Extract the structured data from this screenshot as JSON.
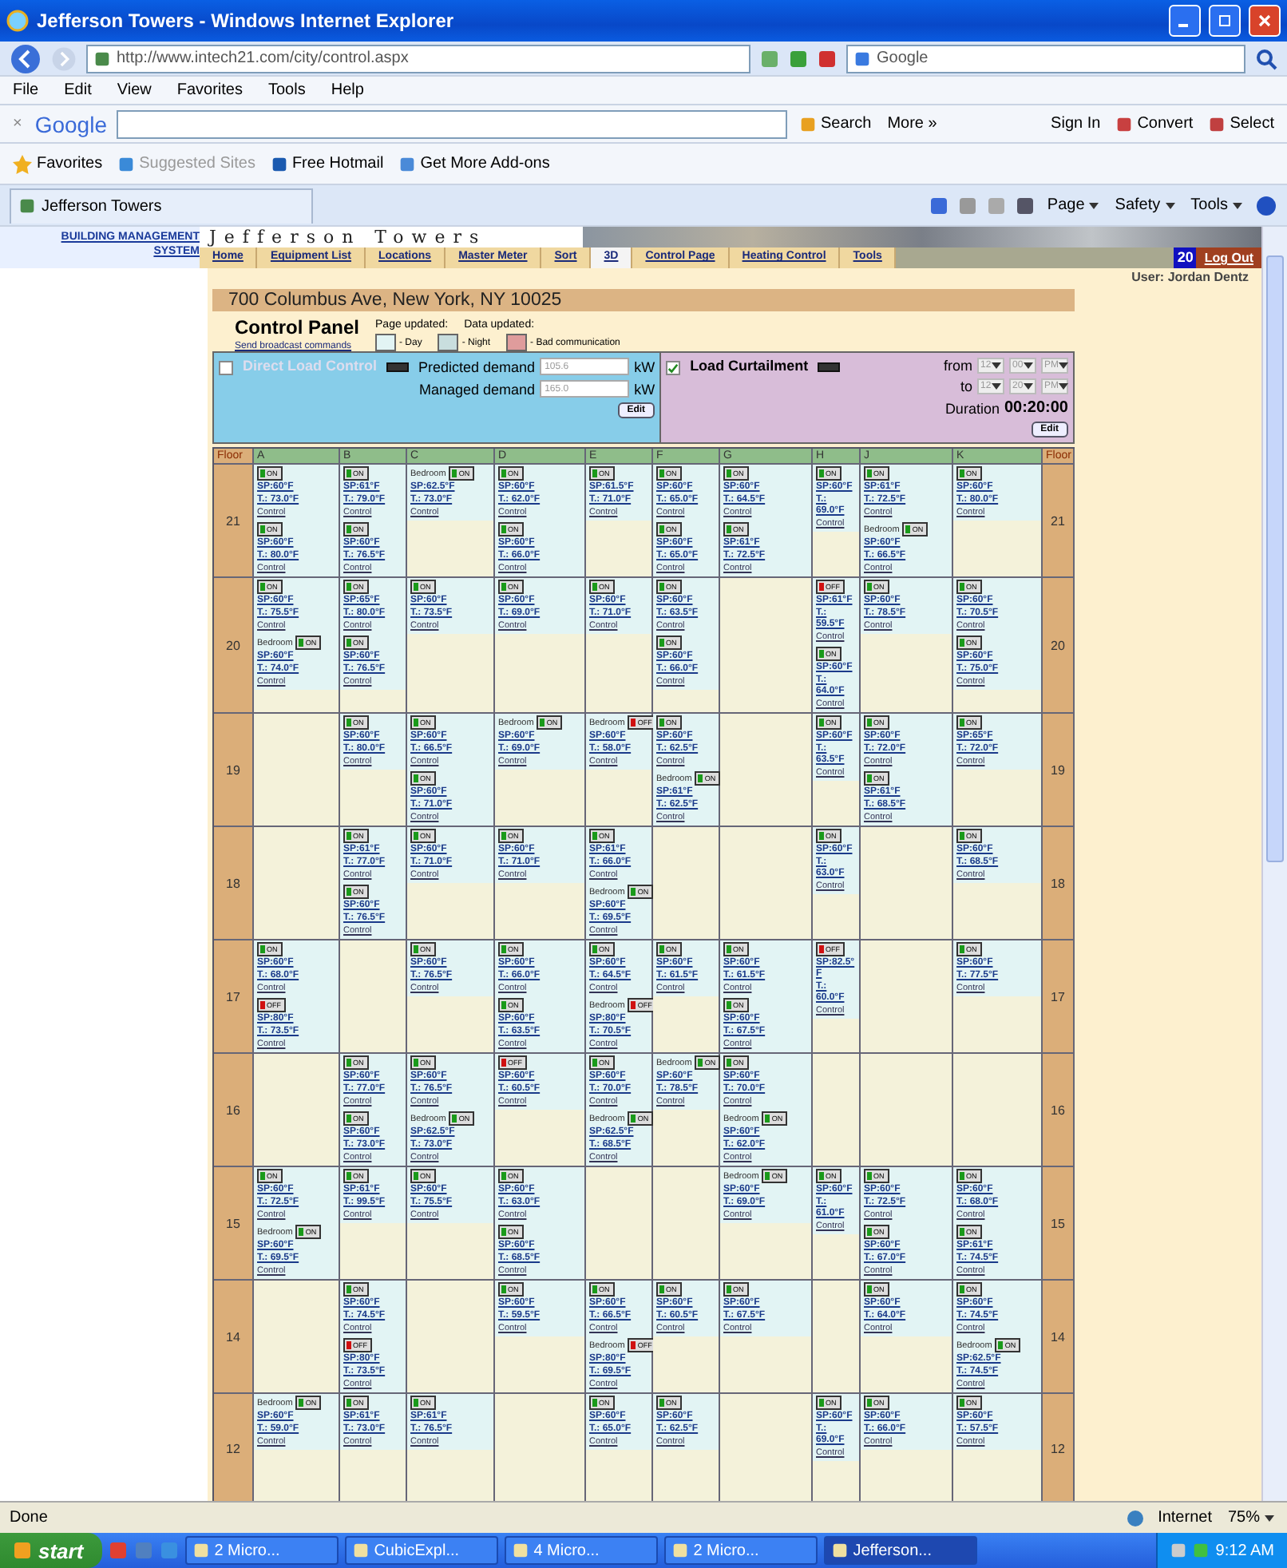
{
  "window": {
    "title": "Jefferson Towers - Windows Internet Explorer"
  },
  "address_bar": {
    "url": "http://www.intech21.com/city/control.aspx",
    "search_placeholder": "Google"
  },
  "menu": [
    "File",
    "Edit",
    "View",
    "Favorites",
    "Tools",
    "Help"
  ],
  "google_toolbar": {
    "close": "×",
    "logo": "Google",
    "search": "Search",
    "more": "More »",
    "sign_in": "Sign In",
    "convert": "Convert",
    "select": "Select"
  },
  "favorites_bar": {
    "favorites": "Favorites",
    "items": [
      "Suggested Sites",
      "Free Hotmail",
      "Get More Add-ons"
    ]
  },
  "tab": {
    "title": "Jefferson Towers"
  },
  "command_bar": [
    "Page",
    "Safety",
    "Tools"
  ],
  "site": {
    "brand": "BUILDING MANAGEMENT SYSTEM",
    "banner": "Jefferson Towers",
    "nav": [
      {
        "label": "Home",
        "selected": false
      },
      {
        "label": "Equipment List",
        "selected": false
      },
      {
        "label": "Locations",
        "selected": false
      },
      {
        "label": "Master Meter",
        "selected": false
      },
      {
        "label": "Sort",
        "selected": false
      },
      {
        "label": "3D",
        "selected": true
      },
      {
        "label": "Control Page",
        "selected": false
      },
      {
        "label": "Heating Control",
        "selected": false
      },
      {
        "label": "Tools",
        "selected": false
      }
    ],
    "badge": "20",
    "logout": "Log Out",
    "user": "User: Jordan Dentz"
  },
  "panel": {
    "address": "700 Columbus Ave, New York, NY 10025",
    "title": "Control Panel",
    "page_updated": "Page updated:",
    "data_updated": "Data updated:",
    "broadcast": "Send broadcast commands",
    "legend": [
      {
        "label": "- Day",
        "color": "#e2f4f4"
      },
      {
        "label": "- Night",
        "color": "#c9dede"
      },
      {
        "label": "- Bad communication",
        "color": "#df9c9c"
      }
    ]
  },
  "direct_load": {
    "checked": false,
    "label": "Direct Load Control",
    "predicted_label": "Predicted demand",
    "predicted": "105.6",
    "predicted_unit": "kW",
    "managed_label": "Managed demand",
    "managed": "165.0",
    "managed_unit": "kW",
    "edit": "Edit"
  },
  "curtailment": {
    "checked": true,
    "label": "Load Curtailment",
    "from_label": "from",
    "from": [
      "12",
      "00",
      "PM"
    ],
    "to_label": "to",
    "to": [
      "12",
      "20",
      "PM"
    ],
    "duration_label": "Duration",
    "duration": "00:20:00",
    "edit": "Edit"
  },
  "grid": {
    "columns": [
      "Floor",
      "A",
      "B",
      "C",
      "D",
      "E",
      "F",
      "G",
      "H",
      "J",
      "K",
      "Floor"
    ],
    "floors": [
      {
        "floor": "21",
        "floor_end": "21",
        "cells": [
          [
            {
              "switch": "ON",
              "on": true,
              "sp": "SP:60°F",
              "t": "T.: 73.0°F",
              "link": "Control"
            },
            {
              "switch": "ON",
              "on": true,
              "sp": "SP:60°F",
              "t": "T.: 80.0°F",
              "link": "Control"
            }
          ],
          [
            {
              "switch": "ON",
              "on": true,
              "sp": "SP:61°F",
              "t": "T.: 79.0°F",
              "link": "Control"
            },
            {
              "switch": "ON",
              "on": true,
              "sp": "SP:60°F",
              "t": "T.: 76.5°F",
              "link": "Control"
            }
          ],
          [
            {
              "room": "Bedroom",
              "switch": "ON",
              "on": true,
              "sp": "SP:62.5°F",
              "t": "T.: 73.0°F",
              "link": "Control"
            }
          ],
          [
            {
              "switch": "ON",
              "on": true,
              "sp": "SP:60°F",
              "t": "T.: 62.0°F",
              "link": "Control"
            },
            {
              "switch": "ON",
              "on": true,
              "sp": "SP:60°F",
              "t": "T.: 66.0°F",
              "link": "Control"
            }
          ],
          [
            {
              "switch": "ON",
              "on": true,
              "sp": "SP:61.5°F",
              "t": "T.: 71.0°F",
              "link": "Control"
            }
          ],
          [
            {
              "switch": "ON",
              "on": true,
              "sp": "SP:60°F",
              "t": "T.: 65.0°F",
              "link": "Control"
            },
            {
              "switch": "ON",
              "on": true,
              "sp": "SP:60°F",
              "t": "T.: 65.0°F",
              "link": "Control"
            }
          ],
          [
            {
              "switch": "ON",
              "on": true,
              "sp": "SP:60°F",
              "t": "T.: 64.5°F",
              "link": "Control"
            },
            {
              "switch": "ON",
              "on": true,
              "sp": "SP:61°F",
              "t": "T.: 72.5°F",
              "link": "Control"
            }
          ],
          [
            {
              "switch": "ON",
              "on": true,
              "sp": "SP:60°F",
              "t": "T.: 69.0°F",
              "link": "Control"
            }
          ],
          [
            {
              "switch": "ON",
              "on": true,
              "sp": "SP:61°F",
              "t": "T.: 72.5°F",
              "link": "Control"
            },
            {
              "room": "Bedroom",
              "switch": "ON",
              "on": true,
              "sp": "SP:60°F",
              "t": "T.: 66.5°F",
              "link": "Control"
            }
          ],
          [
            {
              "switch": "ON",
              "on": true,
              "sp": "SP:60°F",
              "t": "T.: 80.0°F",
              "link": "Control"
            }
          ]
        ]
      },
      {
        "floor": "20",
        "floor_end": "20",
        "cells": [
          [
            {
              "switch": "ON",
              "on": true,
              "sp": "SP:60°F",
              "t": "T.: 75.5°F",
              "link": "Control"
            },
            {
              "room": "Bedroom",
              "switch": "ON",
              "on": true,
              "sp": "SP:60°F",
              "t": "T.: 74.0°F",
              "link": "Control"
            }
          ],
          [
            {
              "switch": "ON",
              "on": true,
              "sp": "SP:65°F",
              "t": "T.: 80.0°F",
              "link": "Control"
            },
            {
              "switch": "ON",
              "on": true,
              "sp": "SP:60°F",
              "t": "T.: 76.5°F",
              "link": "Control"
            }
          ],
          [
            {
              "switch": "ON",
              "on": true,
              "sp": "SP:60°F",
              "t": "T.: 73.5°F",
              "link": "Control"
            }
          ],
          [
            {
              "switch": "ON",
              "on": true,
              "sp": "SP:60°F",
              "t": "T.: 69.0°F",
              "link": "Control"
            }
          ],
          [
            {
              "switch": "ON",
              "on": true,
              "sp": "SP:60°F",
              "t": "T.: 71.0°F",
              "link": "Control"
            }
          ],
          [
            {
              "switch": "ON",
              "on": true,
              "sp": "SP:60°F",
              "t": "T.: 63.5°F",
              "link": "Control"
            },
            {
              "switch": "ON",
              "on": true,
              "sp": "SP:60°F",
              "t": "T.: 66.0°F",
              "link": "Control"
            }
          ],
          [],
          [
            {
              "switch": "OFF",
              "on": false,
              "sp": "SP:61°F",
              "t": "T.: 59.5°F",
              "link": "Control"
            },
            {
              "switch": "ON",
              "on": true,
              "sp": "SP:60°F",
              "t": "T.: 64.0°F",
              "link": "Control"
            }
          ],
          [
            {
              "switch": "ON",
              "on": true,
              "sp": "SP:60°F",
              "t": "T.: 78.5°F",
              "link": "Control"
            }
          ],
          [
            {
              "switch": "ON",
              "on": true,
              "sp": "SP:60°F",
              "t": "T.: 70.5°F",
              "link": "Control"
            },
            {
              "switch": "ON",
              "on": true,
              "sp": "SP:60°F",
              "t": "T.: 75.0°F",
              "link": "Control"
            }
          ]
        ]
      },
      {
        "floor": "19",
        "floor_end": "19",
        "cells": [
          [],
          [
            {
              "switch": "ON",
              "on": true,
              "sp": "SP:60°F",
              "t": "T.: 80.0°F",
              "link": "Control"
            }
          ],
          [
            {
              "switch": "ON",
              "on": true,
              "sp": "SP:60°F",
              "t": "T.: 66.5°F",
              "link": "Control"
            },
            {
              "switch": "ON",
              "on": true,
              "sp": "SP:60°F",
              "t": "T.: 71.0°F",
              "link": "Control"
            }
          ],
          [
            {
              "room": "Bedroom",
              "switch": "ON",
              "on": true,
              "sp": "SP:60°F",
              "t": "T.: 69.0°F",
              "link": "Control"
            }
          ],
          [
            {
              "room": "Bedroom",
              "switch": "OFF",
              "on": false,
              "sp": "SP:60°F",
              "t": "T.: 58.0°F",
              "link": "Control"
            }
          ],
          [
            {
              "switch": "ON",
              "on": true,
              "sp": "SP:60°F",
              "t": "T.: 62.5°F",
              "link": "Control"
            },
            {
              "room": "Bedroom",
              "switch": "ON",
              "on": true,
              "sp": "SP:61°F",
              "t": "T.: 62.5°F",
              "link": "Control"
            }
          ],
          [],
          [
            {
              "switch": "ON",
              "on": true,
              "sp": "SP:60°F",
              "t": "T.: 63.5°F",
              "link": "Control"
            }
          ],
          [
            {
              "switch": "ON",
              "on": true,
              "sp": "SP:60°F",
              "t": "T.: 72.0°F",
              "link": "Control"
            },
            {
              "switch": "ON",
              "on": true,
              "sp": "SP:61°F",
              "t": "T.: 68.5°F",
              "link": "Control"
            }
          ],
          [
            {
              "switch": "ON",
              "on": true,
              "sp": "SP:65°F",
              "t": "T.: 72.0°F",
              "link": "Control"
            }
          ]
        ]
      },
      {
        "floor": "18",
        "floor_end": "18",
        "cells": [
          [],
          [
            {
              "switch": "ON",
              "on": true,
              "sp": "SP:61°F",
              "t": "T.: 77.0°F",
              "link": "Control"
            },
            {
              "switch": "ON",
              "on": true,
              "sp": "SP:60°F",
              "t": "T.: 76.5°F",
              "link": "Control"
            }
          ],
          [
            {
              "switch": "ON",
              "on": true,
              "sp": "SP:60°F",
              "t": "T.: 71.0°F",
              "link": "Control"
            }
          ],
          [
            {
              "switch": "ON",
              "on": true,
              "sp": "SP:60°F",
              "t": "T.: 71.0°F",
              "link": "Control"
            }
          ],
          [
            {
              "switch": "ON",
              "on": true,
              "sp": "SP:61°F",
              "t": "T.: 66.0°F",
              "link": "Control"
            },
            {
              "room": "Bedroom",
              "switch": "ON",
              "on": true,
              "sp": "SP:60°F",
              "t": "T.: 69.5°F",
              "link": "Control"
            }
          ],
          [],
          [],
          [
            {
              "switch": "ON",
              "on": true,
              "sp": "SP:60°F",
              "t": "T.: 63.0°F",
              "link": "Control"
            }
          ],
          [],
          [
            {
              "switch": "ON",
              "on": true,
              "sp": "SP:60°F",
              "t": "T.: 68.5°F",
              "link": "Control"
            }
          ]
        ]
      },
      {
        "floor": "17",
        "floor_end": "17",
        "cells": [
          [
            {
              "switch": "ON",
              "on": true,
              "sp": "SP:60°F",
              "t": "T.: 68.0°F",
              "link": "Control"
            },
            {
              "switch": "OFF",
              "on": false,
              "sp": "SP:80°F",
              "t": "T.: 73.5°F",
              "link": "Control"
            }
          ],
          [],
          [
            {
              "switch": "ON",
              "on": true,
              "sp": "SP:60°F",
              "t": "T.: 76.5°F",
              "link": "Control"
            }
          ],
          [
            {
              "switch": "ON",
              "on": true,
              "sp": "SP:60°F",
              "t": "T.: 66.0°F",
              "link": "Control"
            },
            {
              "switch": "ON",
              "on": true,
              "sp": "SP:60°F",
              "t": "T.: 63.5°F",
              "link": "Control"
            }
          ],
          [
            {
              "switch": "ON",
              "on": true,
              "sp": "SP:60°F",
              "t": "T.: 64.5°F",
              "link": "Control"
            },
            {
              "room": "Bedroom",
              "switch": "OFF",
              "on": false,
              "sp": "SP:80°F",
              "t": "T.: 70.5°F",
              "link": "Control"
            }
          ],
          [
            {
              "switch": "ON",
              "on": true,
              "sp": "SP:60°F",
              "t": "T.: 61.5°F",
              "link": "Control"
            }
          ],
          [
            {
              "switch": "ON",
              "on": true,
              "sp": "SP:60°F",
              "t": "T.: 61.5°F",
              "link": "Control"
            },
            {
              "switch": "ON",
              "on": true,
              "sp": "SP:60°F",
              "t": "T.: 67.5°F",
              "link": "Control"
            }
          ],
          [
            {
              "switch": "OFF",
              "on": false,
              "sp": "SP:82.5°F",
              "t": "T.: 60.0°F",
              "link": "Control"
            }
          ],
          [],
          [
            {
              "switch": "ON",
              "on": true,
              "sp": "SP:60°F",
              "t": "T.: 77.5°F",
              "link": "Control"
            }
          ]
        ]
      },
      {
        "floor": "16",
        "floor_end": "16",
        "cells": [
          [],
          [
            {
              "switch": "ON",
              "on": true,
              "sp": "SP:60°F",
              "t": "T.: 77.0°F",
              "link": "Control"
            },
            {
              "switch": "ON",
              "on": true,
              "sp": "SP:60°F",
              "t": "T.: 73.0°F",
              "link": "Control"
            }
          ],
          [
            {
              "switch": "ON",
              "on": true,
              "sp": "SP:60°F",
              "t": "T.: 76.5°F",
              "link": "Control"
            },
            {
              "room": "Bedroom",
              "switch": "ON",
              "on": true,
              "sp": "SP:62.5°F",
              "t": "T.: 73.0°F",
              "link": "Control"
            }
          ],
          [
            {
              "switch": "OFF",
              "on": false,
              "sp": "SP:60°F",
              "t": "T.: 60.5°F",
              "link": "Control"
            }
          ],
          [
            {
              "switch": "ON",
              "on": true,
              "sp": "SP:60°F",
              "t": "T.: 70.0°F",
              "link": "Control"
            },
            {
              "room": "Bedroom",
              "switch": "ON",
              "on": true,
              "sp": "SP:62.5°F",
              "t": "T.: 68.5°F",
              "link": "Control"
            }
          ],
          [
            {
              "room": "Bedroom",
              "switch": "ON",
              "on": true,
              "sp": "SP:60°F",
              "t": "T.: 78.5°F",
              "link": "Control"
            }
          ],
          [
            {
              "switch": "ON",
              "on": true,
              "sp": "SP:60°F",
              "t": "T.: 70.0°F",
              "link": "Control"
            },
            {
              "room": "Bedroom",
              "switch": "ON",
              "on": true,
              "sp": "SP:60°F",
              "t": "T.: 62.0°F",
              "link": "Control"
            }
          ],
          [],
          [],
          []
        ]
      },
      {
        "floor": "15",
        "floor_end": "15",
        "cells": [
          [
            {
              "switch": "ON",
              "on": true,
              "sp": "SP:60°F",
              "t": "T.: 72.5°F",
              "link": "Control"
            },
            {
              "room": "Bedroom",
              "switch": "ON",
              "on": true,
              "sp": "SP:60°F",
              "t": "T.: 69.5°F",
              "link": "Control"
            }
          ],
          [
            {
              "switch": "ON",
              "on": true,
              "sp": "SP:61°F",
              "t": "T.: 99.5°F",
              "link": "Control"
            }
          ],
          [
            {
              "switch": "ON",
              "on": true,
              "sp": "SP:60°F",
              "t": "T.: 75.5°F",
              "link": "Control"
            }
          ],
          [
            {
              "switch": "ON",
              "on": true,
              "sp": "SP:60°F",
              "t": "T.: 63.0°F",
              "link": "Control"
            },
            {
              "switch": "ON",
              "on": true,
              "sp": "SP:60°F",
              "t": "T.: 68.5°F",
              "link": "Control"
            }
          ],
          [],
          [],
          [
            {
              "room": "Bedroom",
              "switch": "ON",
              "on": true,
              "sp": "SP:60°F",
              "t": "T.: 69.0°F",
              "link": "Control"
            }
          ],
          [
            {
              "switch": "ON",
              "on": true,
              "sp": "SP:60°F",
              "t": "T.: 61.0°F",
              "link": "Control"
            }
          ],
          [
            {
              "switch": "ON",
              "on": true,
              "sp": "SP:60°F",
              "t": "T.: 72.5°F",
              "link": "Control"
            },
            {
              "switch": "ON",
              "on": true,
              "sp": "SP:60°F",
              "t": "T.: 67.0°F",
              "link": "Control"
            }
          ],
          [
            {
              "switch": "ON",
              "on": true,
              "sp": "SP:60°F",
              "t": "T.: 68.0°F",
              "link": "Control"
            },
            {
              "switch": "ON",
              "on": true,
              "sp": "SP:61°F",
              "t": "T.: 74.5°F",
              "link": "Control"
            }
          ]
        ]
      },
      {
        "floor": "14",
        "floor_end": "14",
        "cells": [
          [],
          [
            {
              "switch": "ON",
              "on": true,
              "sp": "SP:60°F",
              "t": "T.: 74.5°F",
              "link": "Control"
            },
            {
              "switch": "OFF",
              "on": false,
              "sp": "SP:80°F",
              "t": "T.: 73.5°F",
              "link": "Control"
            }
          ],
          [],
          [
            {
              "switch": "ON",
              "on": true,
              "sp": "SP:60°F",
              "t": "T.: 59.5°F",
              "link": "Control"
            }
          ],
          [
            {
              "switch": "ON",
              "on": true,
              "sp": "SP:60°F",
              "t": "T.: 66.5°F",
              "link": "Control"
            },
            {
              "room": "Bedroom",
              "switch": "OFF",
              "on": false,
              "sp": "SP:80°F",
              "t": "T.: 69.5°F",
              "link": "Control"
            }
          ],
          [
            {
              "switch": "ON",
              "on": true,
              "sp": "SP:60°F",
              "t": "T.: 60.5°F",
              "link": "Control"
            }
          ],
          [
            {
              "switch": "ON",
              "on": true,
              "sp": "SP:60°F",
              "t": "T.: 67.5°F",
              "link": "Control"
            }
          ],
          [],
          [
            {
              "switch": "ON",
              "on": true,
              "sp": "SP:60°F",
              "t": "T.: 64.0°F",
              "link": "Control"
            }
          ],
          [
            {
              "switch": "ON",
              "on": true,
              "sp": "SP:60°F",
              "t": "T.: 74.5°F",
              "link": "Control"
            },
            {
              "room": "Bedroom",
              "switch": "ON",
              "on": true,
              "sp": "SP:62.5°F",
              "t": "T.: 74.5°F",
              "link": "Control"
            }
          ]
        ]
      },
      {
        "floor": "12",
        "floor_end": "12",
        "cells": [
          [
            {
              "room": "Bedroom",
              "switch": "ON",
              "on": true,
              "sp": "SP:60°F",
              "t": "T.: 59.0°F",
              "link": "Control"
            }
          ],
          [
            {
              "switch": "ON",
              "on": true,
              "sp": "SP:61°F",
              "t": "T.: 73.0°F",
              "link": "Control"
            }
          ],
          [
            {
              "switch": "ON",
              "on": true,
              "sp": "SP:61°F",
              "t": "T.: 76.5°F",
              "link": "Control"
            }
          ],
          [],
          [
            {
              "switch": "ON",
              "on": true,
              "sp": "SP:60°F",
              "t": "T.: 65.0°F",
              "link": "Control"
            }
          ],
          [
            {
              "switch": "ON",
              "on": true,
              "sp": "SP:60°F",
              "t": "T.: 62.5°F",
              "link": "Control"
            }
          ],
          [],
          [
            {
              "switch": "ON",
              "on": true,
              "sp": "SP:60°F",
              "t": "T.: 69.0°F",
              "link": "Control"
            }
          ],
          [
            {
              "switch": "ON",
              "on": true,
              "sp": "SP:60°F",
              "t": "T.: 66.0°F",
              "link": "Control"
            }
          ],
          [
            {
              "switch": "ON",
              "on": true,
              "sp": "SP:60°F",
              "t": "T.: 57.5°F",
              "link": "Control"
            }
          ]
        ]
      }
    ]
  },
  "status_bar": {
    "text": "Done",
    "zone": "Internet",
    "zoom": "75%"
  },
  "taskbar": {
    "start": "start",
    "items": [
      {
        "label": "2 Micro...",
        "selected": false
      },
      {
        "label": "CubicExpl...",
        "selected": false
      },
      {
        "label": "4 Micro...",
        "selected": false
      },
      {
        "label": "2 Micro...",
        "selected": false
      },
      {
        "label": "Jefferson...",
        "selected": true
      }
    ],
    "clock": "9:12 AM"
  }
}
